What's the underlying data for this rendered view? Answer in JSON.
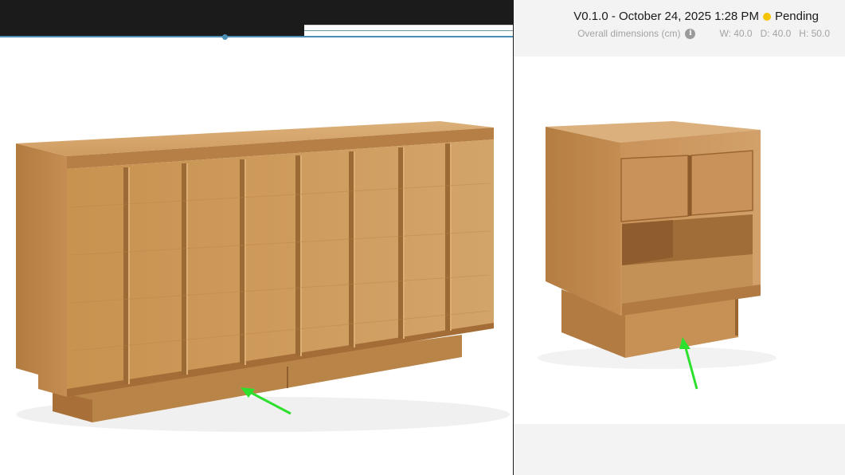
{
  "version": {
    "text": "V0.1.0 - October 24, 2025 1:28 PM",
    "status": "Pending",
    "status_color": "#f5c400"
  },
  "dimensions": {
    "label": "Overall dimensions (cm)",
    "width": "W: 40.0",
    "depth": "D: 40.0",
    "height": "H: 50.0"
  },
  "colors": {
    "wood": "#c8955a",
    "annotation_arrow": "#2ee02e"
  },
  "icons": [
    "info-icon",
    "arrow-annotation"
  ]
}
